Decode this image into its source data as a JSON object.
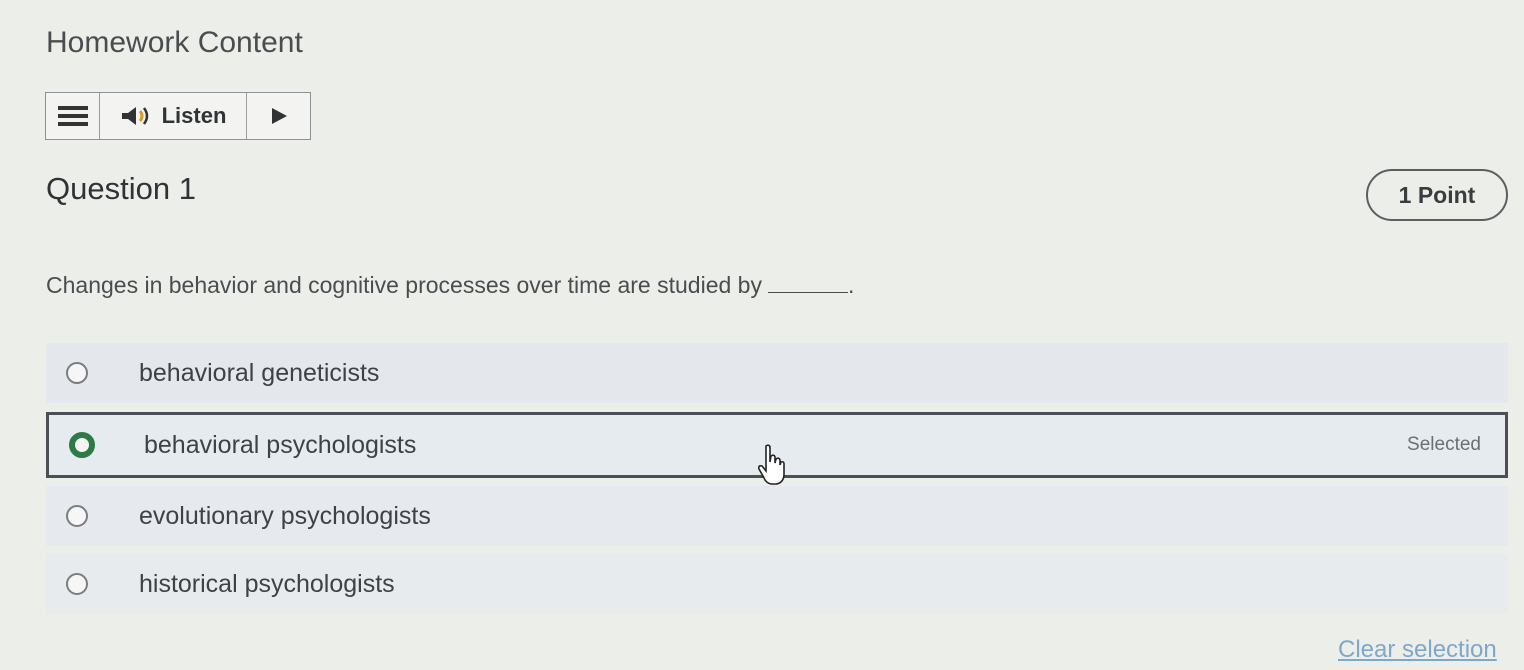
{
  "page": {
    "title": "Homework Content"
  },
  "toolbar": {
    "menu_icon": "hamburger-menu-icon",
    "speaker_icon": "speaker-icon",
    "listen_label": "Listen",
    "play_icon": "play-icon"
  },
  "question": {
    "title": "Question 1",
    "points": "1 Point",
    "prompt": "Changes in behavior and cognitive processes over time are studied by",
    "prompt_end": "."
  },
  "options": [
    {
      "label": "behavioral geneticists",
      "selected": false
    },
    {
      "label": "behavioral psychologists",
      "selected": true,
      "status": "Selected"
    },
    {
      "label": "evolutionary psychologists",
      "selected": false
    },
    {
      "label": "historical psychologists",
      "selected": false
    }
  ],
  "actions": {
    "clear_selection": "Clear selection"
  },
  "colors": {
    "selected_radio": "#2c7a46",
    "link": "#7fa7c9",
    "background": "#eceee9"
  }
}
